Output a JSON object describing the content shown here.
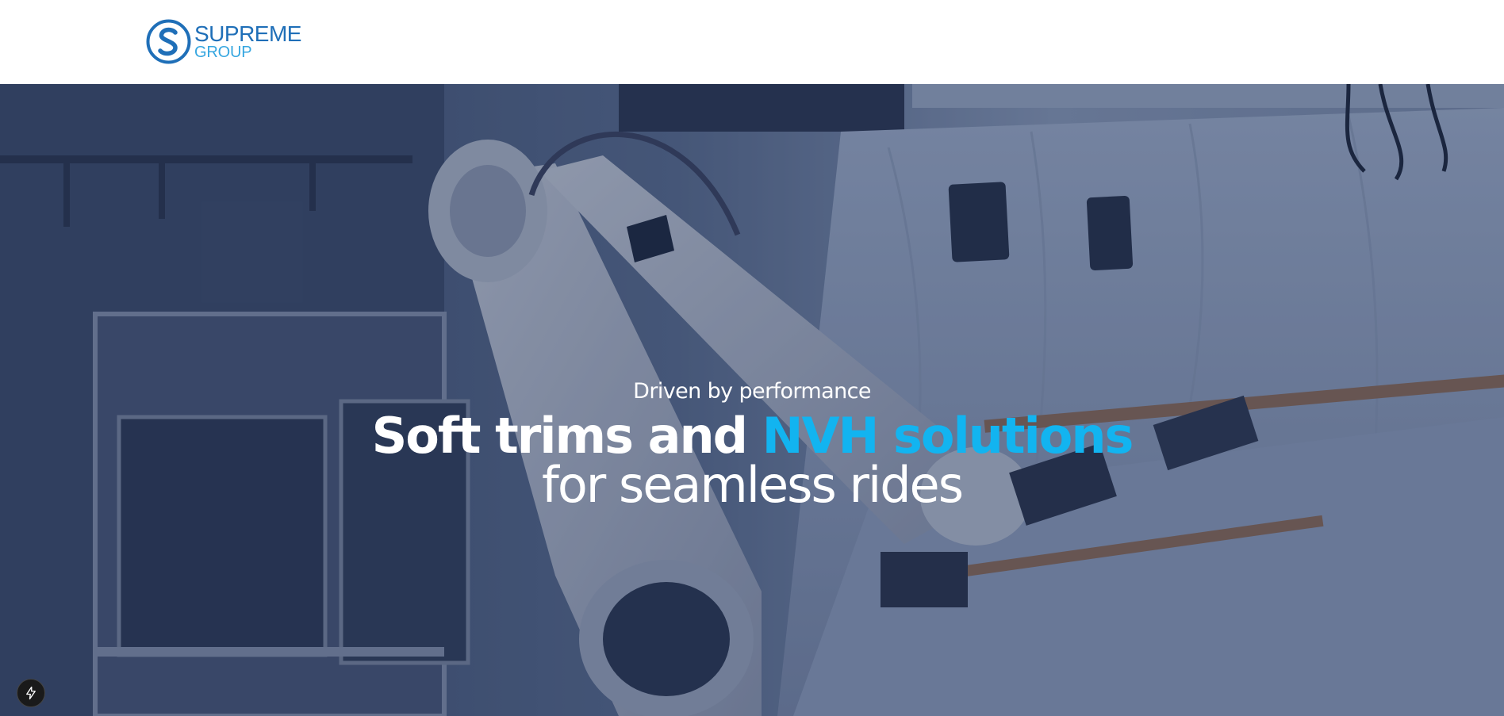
{
  "header": {
    "logo": {
      "primary": "SUPREME",
      "secondary": "GROUP",
      "icon": "supreme-s-logo-icon"
    }
  },
  "hero": {
    "background": "robotic-arm-factory-video",
    "eyebrow": "Driven by performance",
    "title_part1": "Soft trims and ",
    "title_accent": "NVH solutions",
    "title_line2": "for seamless rides"
  },
  "floating_button": {
    "icon": "lightning-bolt-icon"
  },
  "colors": {
    "brand_blue": "#1f6fb8",
    "brand_light_blue": "#35a6e0",
    "accent": "#12b4f0",
    "hero_text": "#ffffff"
  }
}
